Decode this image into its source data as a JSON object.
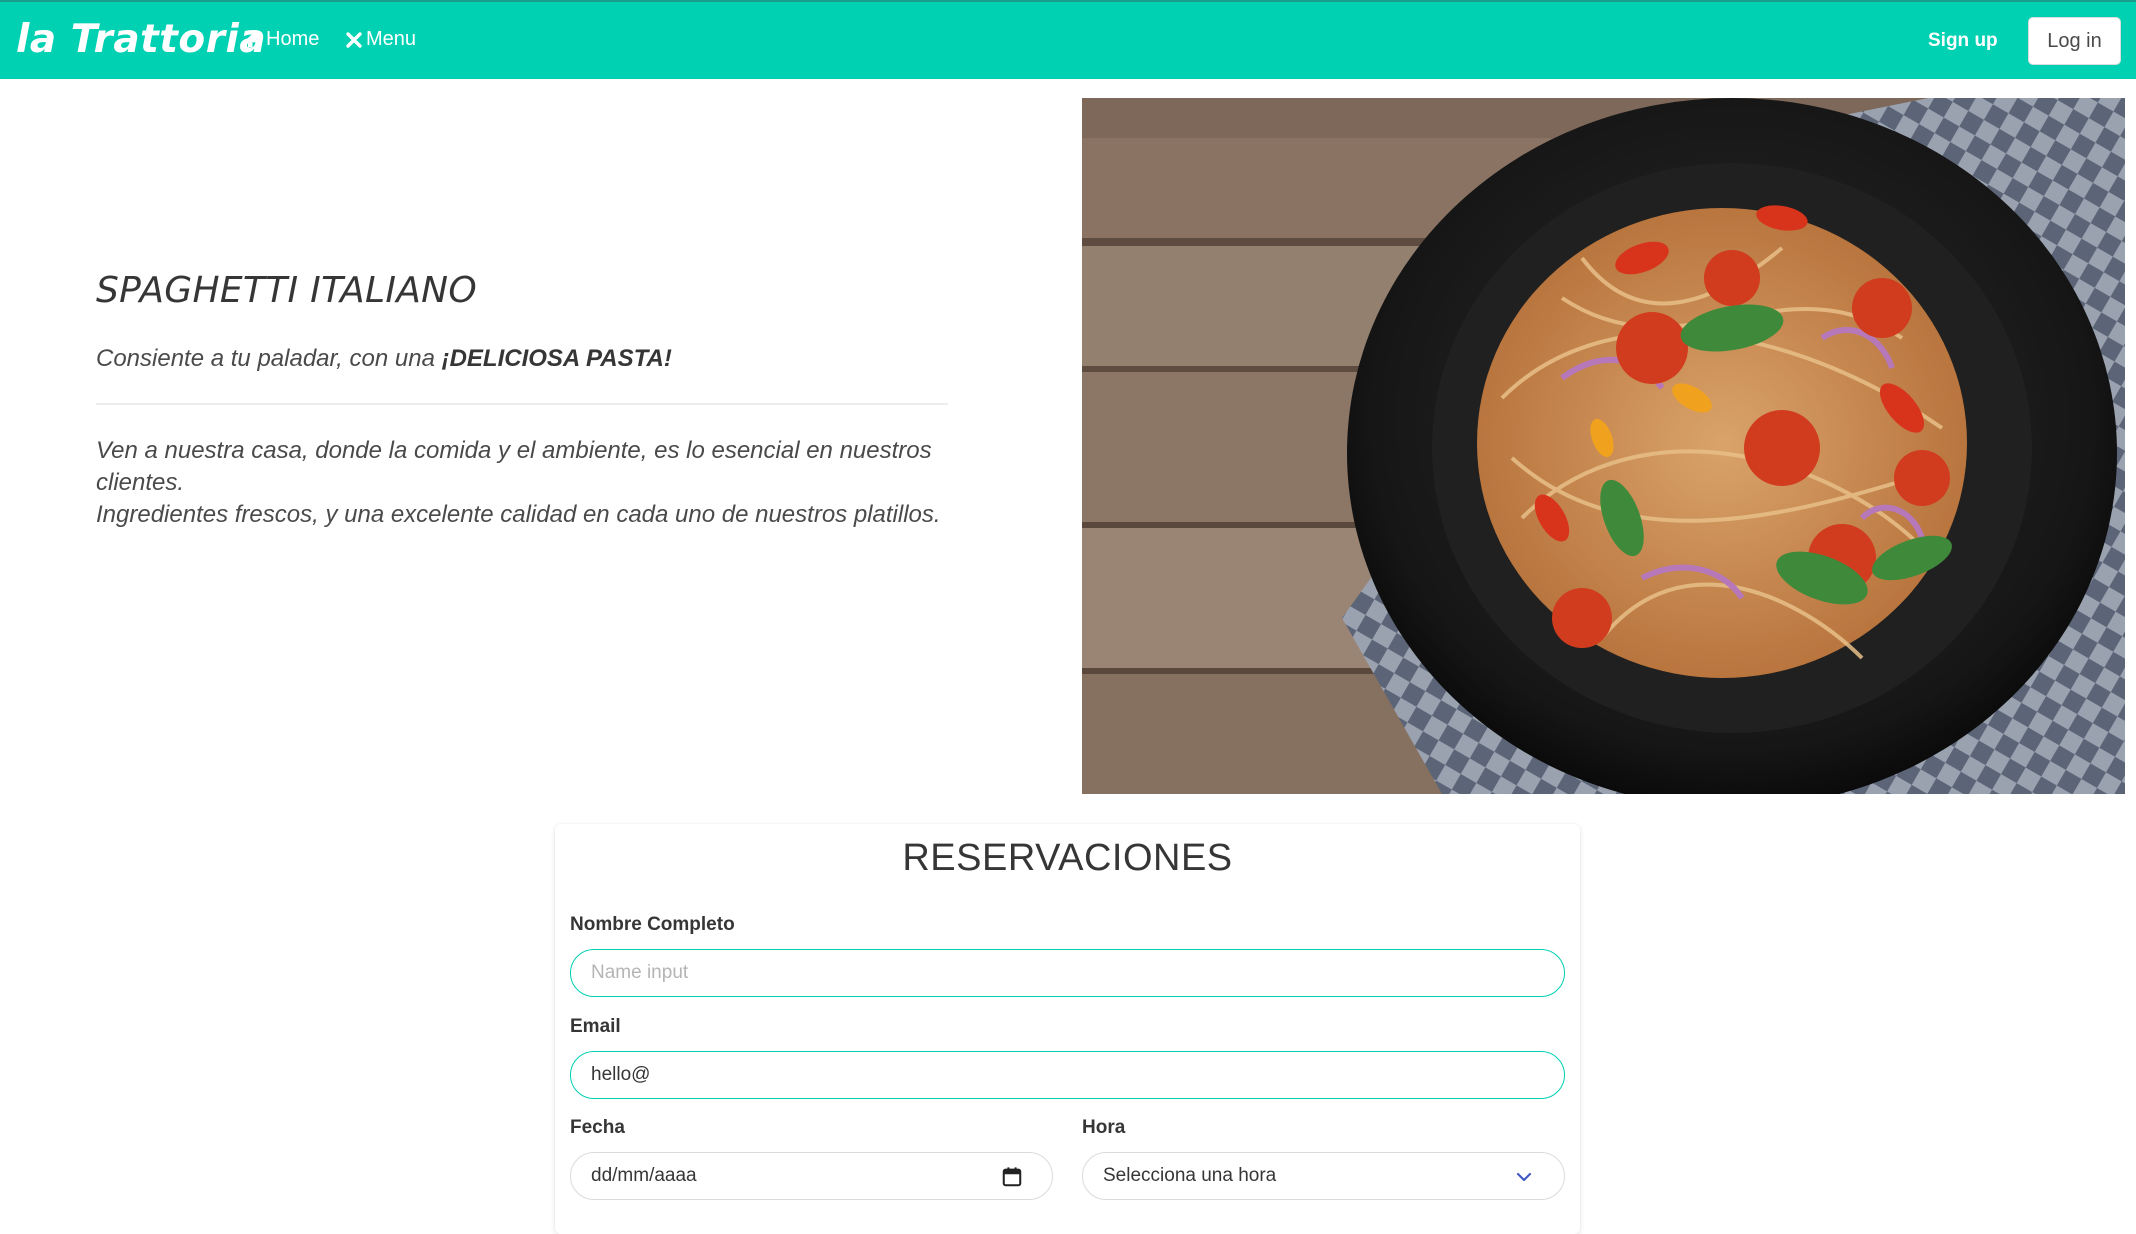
{
  "navbar": {
    "brand": "la Trattoria",
    "home_label": "Home",
    "menu_label": "Menu",
    "signup_label": "Sign up",
    "login_label": "Log in",
    "background_color": "#00d1b2",
    "icons": [
      "home-icon",
      "close-icon"
    ]
  },
  "hero": {
    "title": "SPAGHETTI ITALIANO",
    "subtitle_prefix": "Consiente a tu paladar, con una ",
    "subtitle_emphasis": "¡DELICIOSA PASTA!",
    "text_line1": "Ven a nuestra casa, donde la comida y el ambiente, es lo esencial en nuestros clientes.",
    "text_line2": "Ingredientes frescos, y una excelente calidad en cada uno de nuestros platillos."
  },
  "reservation": {
    "title": "RESERVACIONES",
    "name_label": "Nombre Completo",
    "name_placeholder": "Name input",
    "name_value": "",
    "email_label": "Email",
    "email_value": "hello@",
    "date_label": "Fecha",
    "date_placeholder": "dd/mm/aaaa",
    "time_label": "Hora",
    "time_selected": "Selecciona una hora",
    "accent_color": "#00d1b2"
  }
}
